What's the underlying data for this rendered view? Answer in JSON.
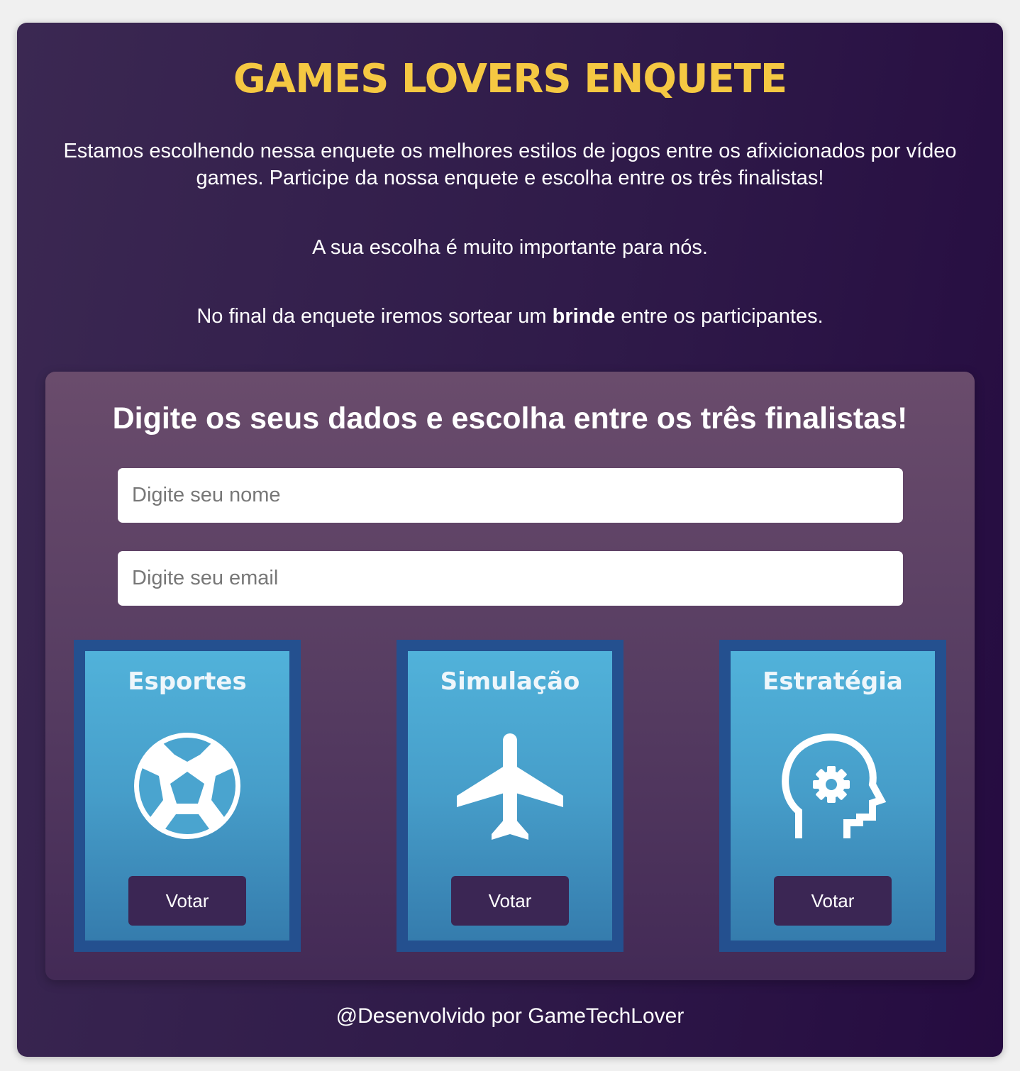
{
  "header": {
    "title": "GAMES LOVERS ENQUETE",
    "intro_text": "Estamos escolhendo nessa enquete os melhores estilos de jogos entre os afixicionados por vídeo games. Participe da nossa enquete e escolha entre os três finalistas!",
    "importance_text": "A sua escolha é muito importante para nós.",
    "prize_prefix": "No final da enquete iremos sortear um ",
    "prize_bold": "brinde",
    "prize_suffix": " entre os participantes."
  },
  "form": {
    "title": "Digite os seus dados e escolha entre os três finalistas!",
    "name_placeholder": "Digite seu nome",
    "email_placeholder": "Digite seu email"
  },
  "options": [
    {
      "label": "Esportes",
      "icon": "soccer-ball-icon",
      "button": "Votar"
    },
    {
      "label": "Simulação",
      "icon": "airplane-icon",
      "button": "Votar"
    },
    {
      "label": "Estratégia",
      "icon": "head-gear-icon",
      "button": "Votar"
    }
  ],
  "footer": {
    "text": "@Desenvolvido por GameTechLover"
  },
  "colors": {
    "title": "#f5c842",
    "card_border": "#24508f",
    "button": "#3b2654"
  }
}
